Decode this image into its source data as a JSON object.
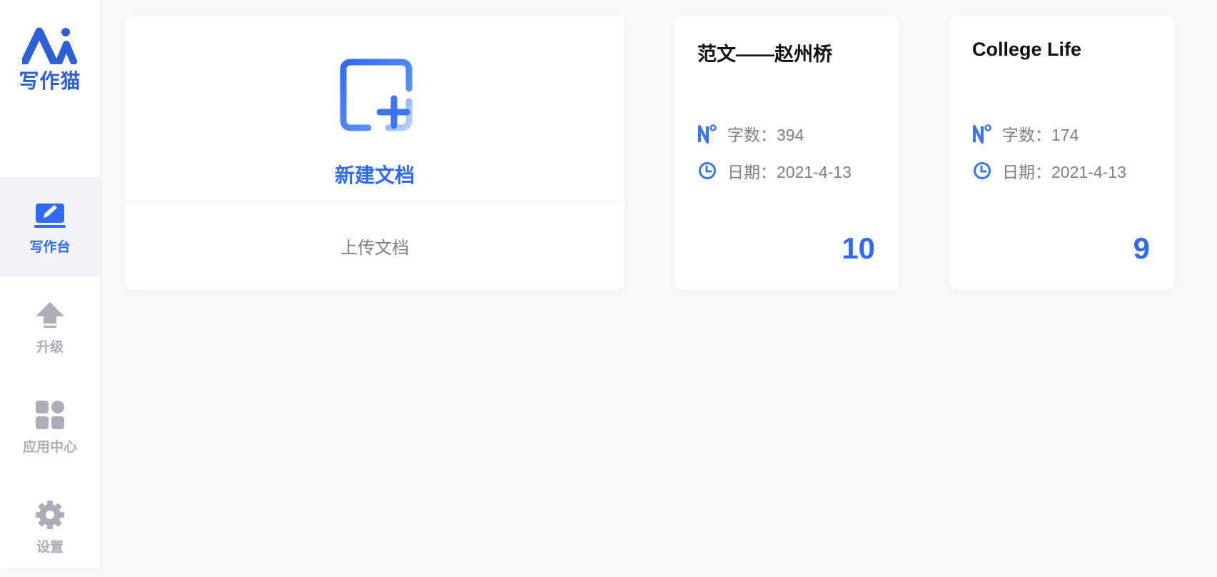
{
  "brand": {
    "logo_text": "写作猫",
    "accent_color": "#2f6af2",
    "logo_color": "#2f5fd6"
  },
  "sidebar": {
    "items": [
      {
        "label": "写作台",
        "icon": "laptop-edit-icon",
        "active": true
      },
      {
        "label": "升级",
        "icon": "upgrade-arrow-icon",
        "active": false
      },
      {
        "label": "应用中心",
        "icon": "app-grid-icon",
        "active": false
      },
      {
        "label": "设置",
        "icon": "gear-icon",
        "active": false
      }
    ]
  },
  "new_doc": {
    "label": "新建文档",
    "icon": "new-document-icon",
    "upload_label": "上传文档"
  },
  "documents": [
    {
      "title": "范文——赵州桥",
      "words_label": "字数：394",
      "date_label": "日期：2021-4-13",
      "count": "10"
    },
    {
      "title": "College Life",
      "words_label": "字数：174",
      "date_label": "日期：2021-4-13",
      "count": "9"
    }
  ]
}
